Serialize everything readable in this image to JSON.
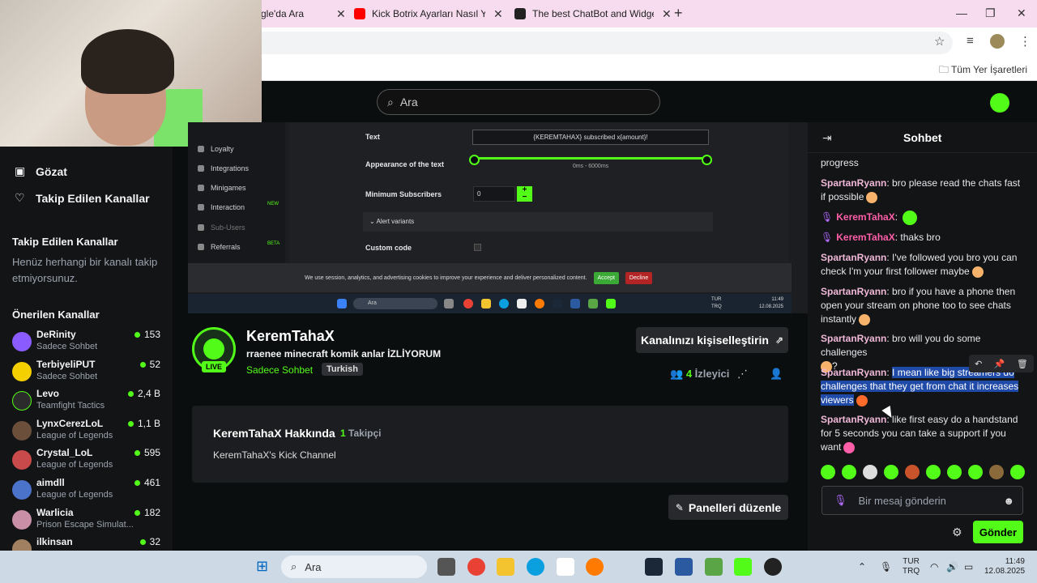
{
  "browser": {
    "tabs": [
      {
        "label": "gle'da Ara",
        "color": "#4285f4"
      },
      {
        "label": "Kick Botrix Ayarları Nasıl Yapılır",
        "color": "#ff0000"
      },
      {
        "label": "The best ChatBot and Widgets",
        "color": "#222222"
      }
    ],
    "bookmarks_label": "Tüm Yer İşaretleri"
  },
  "kick": {
    "search_placeholder": "Ara",
    "brand_color": "#53fc18"
  },
  "sidebar": {
    "nav": [
      {
        "icon": "browse-icon",
        "glyph": "▣",
        "label": "Gözat"
      },
      {
        "icon": "heart-icon",
        "glyph": "♡",
        "label": "Takip Edilen Kanallar"
      }
    ],
    "followed_title": "Takip Edilen Kanallar",
    "followed_empty": "Henüz herhangi bir kanalı takip etmiyorsunuz.",
    "recommended_title": "Önerilen Kanallar",
    "channels": [
      {
        "name": "DeRinity",
        "category": "Sadece Sohbet",
        "viewers": "153",
        "color": "#8a5cff"
      },
      {
        "name": "TerbiyeliPUT",
        "category": "Sadece Sohbet",
        "viewers": "52",
        "color": "#f5d000"
      },
      {
        "name": "Levo",
        "category": "Teamfight Tactics",
        "viewers": "2,4 B",
        "color": "#2b2b2b"
      },
      {
        "name": "LynxCerezLoL",
        "category": "League of Legends",
        "viewers": "1,1 B",
        "color": "#6b4f3a"
      },
      {
        "name": "Crystal_LoL",
        "category": "League of Legends",
        "viewers": "595",
        "color": "#c94a4a"
      },
      {
        "name": "aimdll",
        "category": "League of Legends",
        "viewers": "461",
        "color": "#4a73c9"
      },
      {
        "name": "Warlicia",
        "category": "Prison Escape Simulat...",
        "viewers": "182",
        "color": "#c98fa7"
      },
      {
        "name": "ilkinsan",
        "category": "",
        "viewers": "32",
        "color": "#a08060"
      }
    ]
  },
  "video": {
    "menu": [
      "Loyalty",
      "Integrations",
      "Minigames",
      "Interaction",
      "Sub-Users",
      "Referrals"
    ],
    "badges": {
      "new": "NEW",
      "beta": "BETA"
    },
    "labels": {
      "text": "Text",
      "appearance": "Appearance of the text",
      "min_subs": "Minimum Subscribers",
      "custom_code": "Custom code"
    },
    "text_value": "{KEREMTAHAX} subscribed x{amount}!",
    "range": "0ms - 6000ms",
    "min_subs_value": "0",
    "variants": "Alert variants",
    "cookie": "We use session, analytics, and advertising cookies to improve your experience and deliver personalized content.",
    "accept": "Accept",
    "decline": "Decline",
    "taskbar_search": "Ara",
    "lang": "TUR",
    "lang2": "TRQ",
    "time": "11:49",
    "date": "12.08.2025"
  },
  "channel": {
    "name": "KeremTahaX",
    "live": "LIVE",
    "title": "rraenee minecraft komik anlar İZLİYORUM",
    "category": "Sadece Sohbet",
    "tag": "Turkish",
    "customize": "Kanalınızı kişiselleştirin",
    "viewers_count": "4",
    "viewers_label": "İzleyici",
    "about_title": "KeremTahaX Hakkında",
    "followers_count": "1",
    "followers_label": "Takipçi",
    "about_desc": "KeremTahaX's Kick Channel",
    "edit_panels": "Panelleri düzenle"
  },
  "chat": {
    "title": "Sohbet",
    "messages": [
      {
        "user": "",
        "text": "progress"
      },
      {
        "user": "SpartanRyann",
        "text": "bro please read the chats fast if possible"
      },
      {
        "user": "KeremTahaX",
        "text": ""
      },
      {
        "user": "KeremTahaX",
        "text": "thaks bro"
      },
      {
        "user": "SpartanRyann",
        "text": "I've followed you bro you can check I'm your first follower maybe"
      },
      {
        "user": "SpartanRyann",
        "text": "bro if you have a phone then open your stream on phone too to see chats instantly"
      },
      {
        "user": "SpartanRyann",
        "text": "bro will you do some challenges"
      },
      {
        "user": "SpartanRyann",
        "text": "I mean like big streamers do challenges that they get from chat it increases viewers"
      },
      {
        "user": "SpartanRyann",
        "text": "like first easy do a handstand for 5 seconds you can take a support if you want"
      }
    ],
    "question_mark": "?",
    "input_placeholder": "Bir mesaj gönderin",
    "send": "Gönder"
  },
  "taskbar": {
    "search": "Ara",
    "lang": "TUR",
    "lang2": "TRQ",
    "time": "11:49",
    "date": "12.08.2025"
  }
}
